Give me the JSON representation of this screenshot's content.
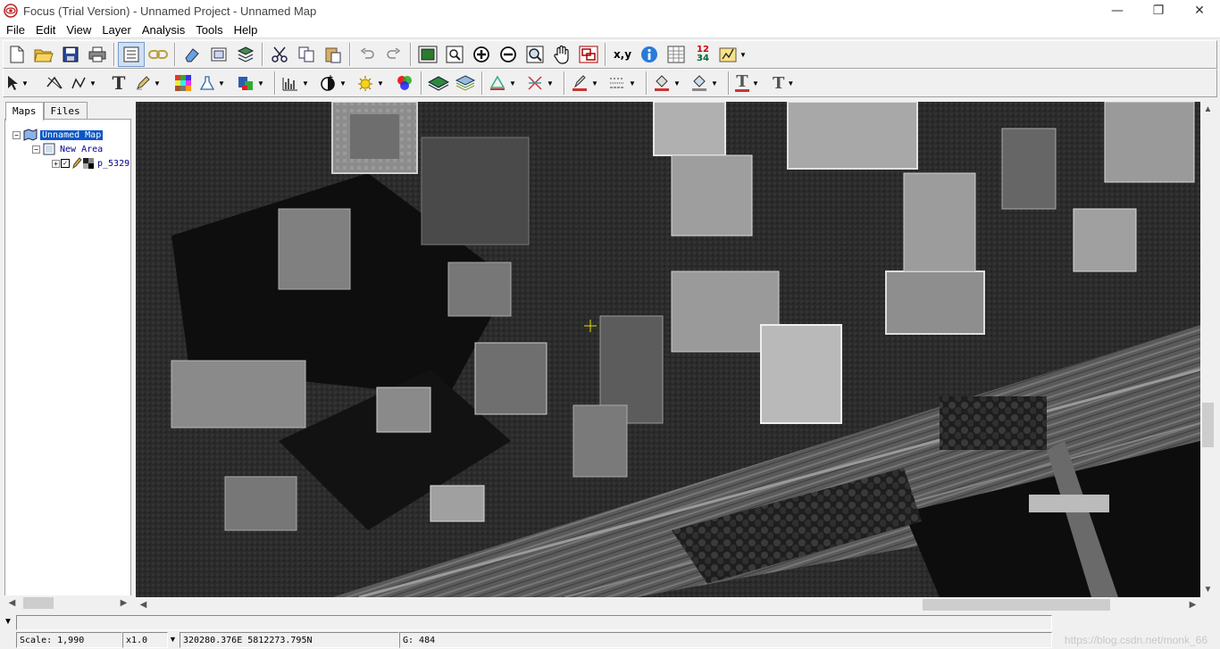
{
  "window": {
    "title": "Focus (Trial Version) - Unnamed Project - Unnamed Map",
    "minimize": "—",
    "restore": "❐",
    "close": "✕"
  },
  "menu": [
    "File",
    "Edit",
    "View",
    "Layer",
    "Analysis",
    "Tools",
    "Help"
  ],
  "toolbar1": {
    "coord_label": "x,y",
    "numbers_label_top": "12",
    "numbers_label_bottom": "34"
  },
  "toolbar2": {
    "text_tool_label": "T",
    "text_style1_label": "T",
    "text_style2_label": "T"
  },
  "left_panel": {
    "tabs": [
      "Maps",
      "Files"
    ],
    "tree": {
      "map": "Unnamed Map",
      "area": "New Area",
      "layer": "p_5329"
    }
  },
  "map_view": {
    "icon": "aerial-image"
  },
  "statusbar": {
    "scale": "Scale: 1,990",
    "zoom": "x1.0",
    "coords": "320280.376E 5812273.795N",
    "channel": "G:  484",
    "watermark": "https://blog.csdn.net/monk_66"
  }
}
